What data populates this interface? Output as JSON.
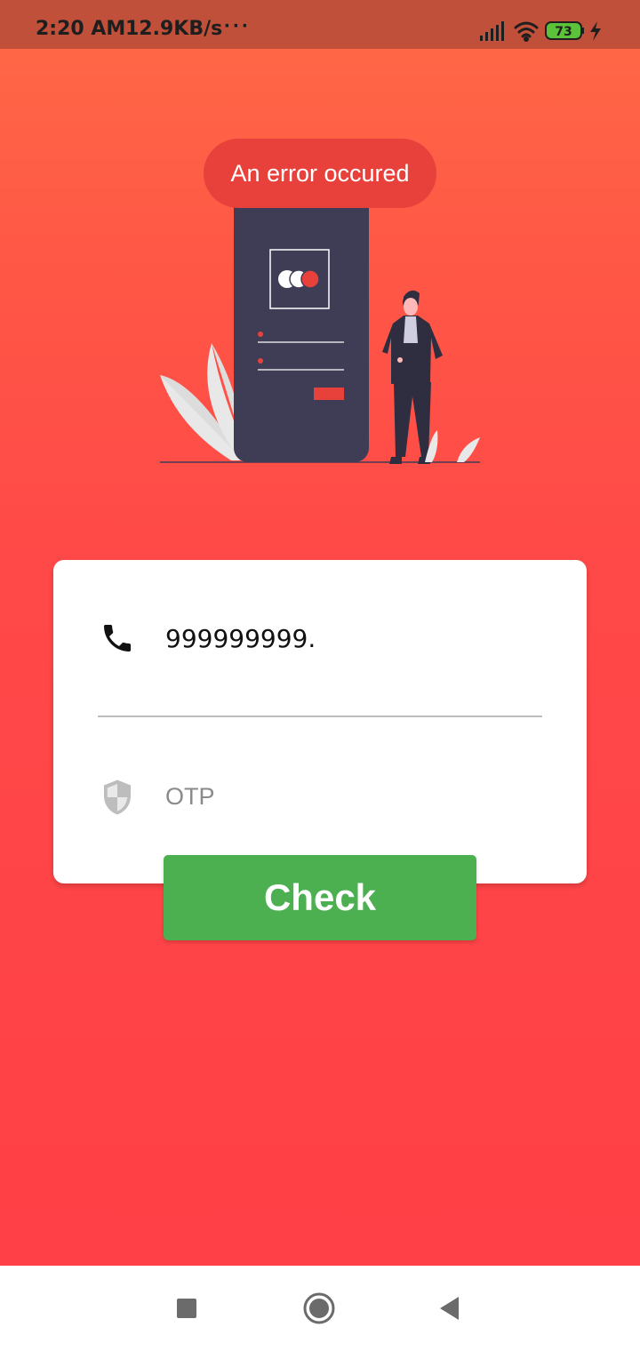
{
  "status_bar": {
    "time": "2:20 AM",
    "network_speed": "12.9KB/s",
    "overflow": "···",
    "battery_level": "73",
    "icons": [
      "signal-icon",
      "wifi-icon",
      "battery-icon",
      "charging-icon"
    ]
  },
  "illustration": {
    "description_icon": "phone-illustration-icon"
  },
  "toast": {
    "message": "An error occured"
  },
  "form": {
    "phone_value": "999999999.",
    "otp_placeholder": "OTP",
    "otp_value": "",
    "check_label": "Check"
  },
  "nav_bar": {
    "icons": [
      "recent-apps-icon",
      "home-icon",
      "back-icon"
    ]
  },
  "colors": {
    "accent_red": "#ff4346",
    "toast_red": "#e8413c",
    "button_green": "#4caf50",
    "status_bar": "#c0503a"
  }
}
